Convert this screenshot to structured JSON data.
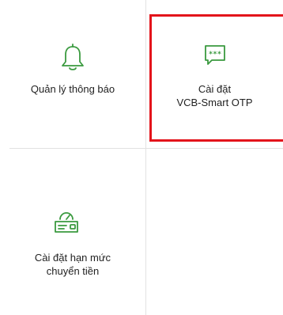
{
  "tiles": [
    {
      "icon": "bell-icon",
      "label": "Quản lý thông báo"
    },
    {
      "icon": "otp-message-icon",
      "label": "Cài đặt\nVCB-Smart OTP",
      "highlighted": true
    },
    {
      "icon": "speedometer-card-icon",
      "label": "Cài đặt hạn mức\nchuyển tiền"
    }
  ],
  "colors": {
    "accent_green": "#3a9a3f",
    "highlight_red": "#e3141b",
    "divider": "#e2e2e2",
    "text": "#222222"
  }
}
